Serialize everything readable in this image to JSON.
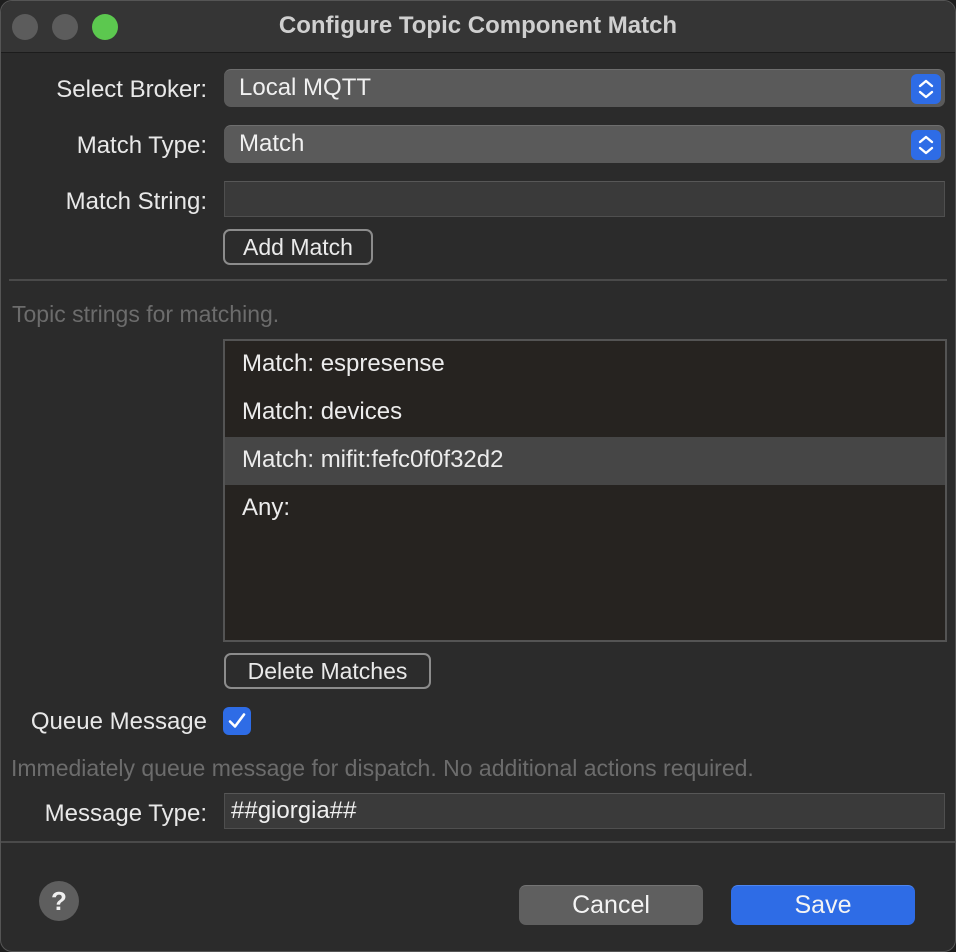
{
  "window": {
    "title": "Configure Topic Component Match"
  },
  "broker": {
    "label": "Select Broker:",
    "selected": "Local MQTT"
  },
  "match_type": {
    "label": "Match Type:",
    "selected": "Match"
  },
  "match_string": {
    "label": "Match String:",
    "value": ""
  },
  "add_match_label": "Add Match",
  "topic_hint": "Topic strings for matching.",
  "matches": [
    {
      "text": "Match: espresense",
      "selected": false
    },
    {
      "text": "Match: devices",
      "selected": false
    },
    {
      "text": "Match: mifit:fefc0f0f32d2",
      "selected": true
    },
    {
      "text": "Any:",
      "selected": false
    }
  ],
  "delete_matches_label": "Delete Matches",
  "queue_message": {
    "label": "Queue Message",
    "checked": true,
    "hint": "Immediately queue message for dispatch.  No additional actions required."
  },
  "message_type": {
    "label": "Message Type:",
    "value": "##giorgia##"
  },
  "footer": {
    "help_label": "?",
    "cancel_label": "Cancel",
    "save_label": "Save"
  },
  "colors": {
    "accent": "#2e6ce6",
    "zoom_button": "#5cc84f"
  },
  "icons": [
    "popup-stepper-icon",
    "checkmark-icon",
    "help-icon"
  ]
}
